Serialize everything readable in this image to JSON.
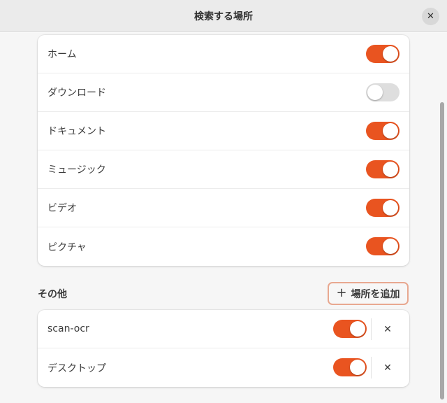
{
  "window": {
    "title": "検索する場所",
    "close_symbol": "✕"
  },
  "default_locations": [
    {
      "label": "ホーム",
      "enabled": true
    },
    {
      "label": "ダウンロード",
      "enabled": false
    },
    {
      "label": "ドキュメント",
      "enabled": true
    },
    {
      "label": "ミュージック",
      "enabled": true
    },
    {
      "label": "ビデオ",
      "enabled": true
    },
    {
      "label": "ピクチャ",
      "enabled": true
    }
  ],
  "other_section": {
    "title": "その他",
    "add_button": {
      "icon": "plus-icon",
      "symbol": "+",
      "label": "場所を追加"
    },
    "remove_symbol": "✕",
    "locations": [
      {
        "label": "scan-ocr",
        "enabled": true
      },
      {
        "label": "デスクトップ",
        "enabled": true
      }
    ]
  },
  "colors": {
    "accent": "#e95420",
    "switch_off": "#dedede"
  }
}
